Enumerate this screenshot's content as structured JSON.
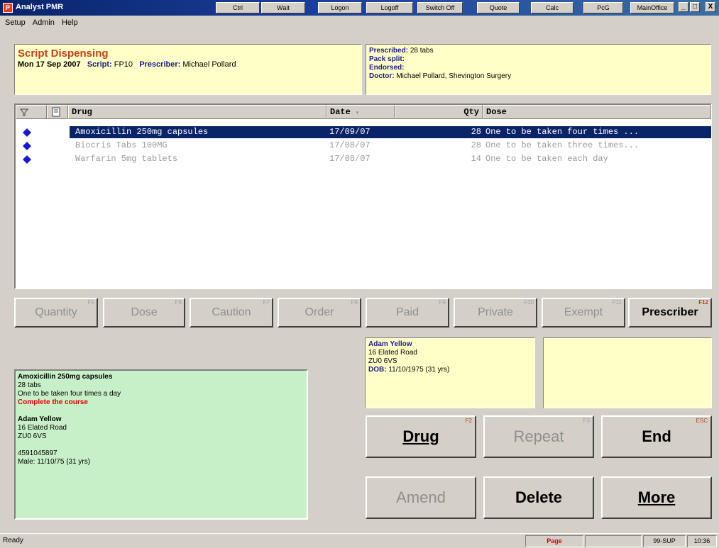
{
  "window": {
    "title": "Analyst PMR",
    "toolbar": [
      "Ctrl",
      "Wait",
      "Logon",
      "Logoff",
      "Switch Off",
      "Quote",
      "Calc",
      "PcG",
      "MainOffice"
    ],
    "controls": [
      "_",
      "□",
      "X"
    ]
  },
  "menu": [
    "Setup",
    "Admin",
    "Help"
  ],
  "header": {
    "mode": "Script Dispensing",
    "date": "Mon 17 Sep 2007",
    "script_label": "Script:",
    "script_value": "FP10",
    "prescriber_label": "Prescriber:",
    "prescriber_value": "Michael Pollard"
  },
  "info": {
    "prescribed_label": "Prescribed:",
    "prescribed_value": "28 tabs",
    "pack_split_label": "Pack split:",
    "endorsed_label": "Endorsed:",
    "doctor_label": "Doctor:",
    "doctor_value": "Michael Pollard, Shevington Surgery"
  },
  "list": {
    "columns": {
      "drug": "Drug",
      "date": "Date",
      "qty": "Qty",
      "dose": "Dose"
    },
    "rows": [
      {
        "drug": "Amoxicillin 250mg capsules",
        "date": "17/09/07",
        "qty": "28",
        "dose": "One to be taken four times ..."
      },
      {
        "drug": "Biocris Tabs 100MG",
        "date": "17/08/07",
        "qty": "28",
        "dose": "One to be taken three times..."
      },
      {
        "drug": "Warfarin 5mg tablets",
        "date": "17/08/07",
        "qty": "14",
        "dose": "One to be taken each day"
      }
    ]
  },
  "function_buttons": [
    {
      "label": "Quantity",
      "key": "F5"
    },
    {
      "label": "Dose",
      "key": "F6"
    },
    {
      "label": "Caution",
      "key": "F7"
    },
    {
      "label": "Order",
      "key": "F8"
    },
    {
      "label": "Paid",
      "key": "F9"
    },
    {
      "label": "Private",
      "key": "F10"
    },
    {
      "label": "Exempt",
      "key": "F11"
    },
    {
      "label": "Prescriber",
      "key": "F12"
    }
  ],
  "patient": {
    "name": "Adam Yellow",
    "address1": "16 Elated Road",
    "postcode": "ZU0 6VS",
    "dob_label": "DOB:",
    "dob_value": "11/10/1975 (31 yrs)"
  },
  "label_preview": {
    "drug": "Amoxicillin 250mg capsules",
    "qty": "28 tabs",
    "dose": "One to be taken four times a day",
    "warning": "Complete the course",
    "patient_name": "Adam Yellow",
    "address1": "16 Elated Road",
    "postcode": "ZU0 6VS",
    "number": "4591045897",
    "sex_dob": "Male: 11/10/75 (31 yrs)"
  },
  "actions": {
    "drug": {
      "label": "Drug",
      "key": "F2"
    },
    "repeat": {
      "label": "Repeat",
      "key": "F3"
    },
    "end": {
      "label": "End",
      "key": "ESC"
    },
    "amend": {
      "label": "Amend"
    },
    "delete": {
      "label": "Delete"
    },
    "more": {
      "label": "More"
    }
  },
  "status": {
    "text": "Ready",
    "page": "Page",
    "user": "99-SUP",
    "time": "10:36"
  },
  "colors": {
    "title_bar": "#0a246a",
    "header_mode": "#c0401a",
    "selected_row": "#0a246a",
    "bullet": "#1a1acd",
    "warning": "#e00000",
    "yellow_panel": "#ffffc8",
    "green_panel": "#c8f0c8"
  }
}
